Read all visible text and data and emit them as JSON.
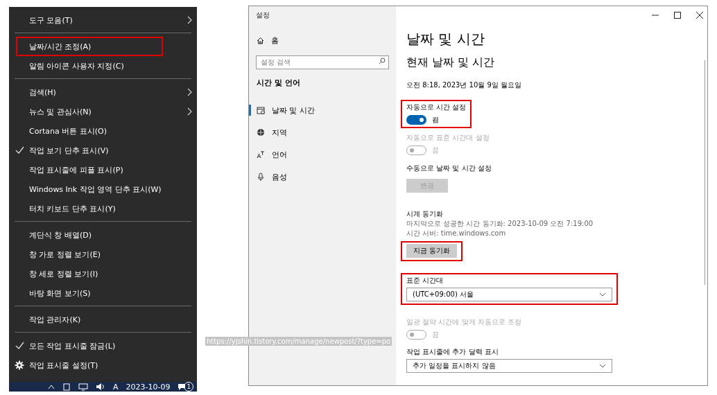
{
  "context_menu": {
    "groups": [
      [
        {
          "label": "도구 모음(T)",
          "kind": "plain",
          "checked": false,
          "submenu": true,
          "marked": false
        }
      ],
      [
        {
          "label": "날짜/시간 조정(A)",
          "kind": "plain",
          "checked": false,
          "submenu": false,
          "marked": true
        },
        {
          "label": "알림 아이콘 사용자 지정(C)",
          "kind": "plain",
          "checked": false,
          "submenu": false,
          "marked": false
        }
      ],
      [
        {
          "label": "검색(H)",
          "kind": "plain",
          "checked": false,
          "submenu": true,
          "marked": false
        },
        {
          "label": "뉴스 및 관심사(N)",
          "kind": "plain",
          "checked": false,
          "submenu": true,
          "marked": false
        },
        {
          "label": "Cortana 버튼 표시(O)",
          "kind": "plain",
          "checked": false,
          "submenu": false,
          "marked": false
        },
        {
          "label": "작업 보기 단추 표시(V)",
          "kind": "plain",
          "checked": true,
          "submenu": false,
          "marked": false
        },
        {
          "label": "작업 표시줄에 피플 표시(P)",
          "kind": "plain",
          "checked": false,
          "submenu": false,
          "marked": false
        },
        {
          "label": "Windows Ink 작업 영역 단추 표시(W)",
          "kind": "plain",
          "checked": false,
          "submenu": false,
          "marked": false
        },
        {
          "label": "터치 키보드 단추 표시(Y)",
          "kind": "plain",
          "checked": false,
          "submenu": false,
          "marked": false
        }
      ],
      [
        {
          "label": "계단식 창 배열(D)",
          "kind": "plain",
          "checked": false,
          "submenu": false,
          "marked": false
        },
        {
          "label": "창 가로 정렬 보기(E)",
          "kind": "plain",
          "checked": false,
          "submenu": false,
          "marked": false
        },
        {
          "label": "창 세로 정렬 보기(I)",
          "kind": "plain",
          "checked": false,
          "submenu": false,
          "marked": false
        },
        {
          "label": "바탕 화면 보기(S)",
          "kind": "plain",
          "checked": false,
          "submenu": false,
          "marked": false
        }
      ],
      [
        {
          "label": "작업 관리자(K)",
          "kind": "plain",
          "checked": false,
          "submenu": false,
          "marked": false
        }
      ],
      [
        {
          "label": "모든 작업 표시줄 잠금(L)",
          "kind": "plain",
          "checked": true,
          "submenu": false,
          "marked": false
        },
        {
          "label": "작업 표시줄 설정(T)",
          "kind": "settings",
          "checked": false,
          "submenu": false,
          "marked": false
        }
      ]
    ]
  },
  "taskbar": {
    "ime": "A",
    "date": "2023-10-09",
    "notification_count": "1"
  },
  "link_tooltip": "https://yjshin.tistory.com/manage/newpost/?type=po",
  "settings_window": {
    "title": "설정",
    "sidebar": {
      "home": "홈",
      "search": {
        "placeholder": "설정 검색"
      },
      "heading": "시간 및 언어",
      "items": [
        {
          "label": "날짜 및 시간",
          "selected": true
        },
        {
          "label": "지역",
          "selected": false
        },
        {
          "label": "언어",
          "selected": false
        },
        {
          "label": "음성",
          "selected": false
        }
      ]
    },
    "content": {
      "title": "날짜 및 시간",
      "subtitle": "현재 날짜 및 시간",
      "current_time": "오전 8:18, 2023년 10월 9일 월요일",
      "sections": [
        {
          "kind": "toggle",
          "label": "자동으로 시간 설정",
          "on": true,
          "state_text": "켬",
          "disabled": false,
          "marked": true
        },
        {
          "kind": "toggle",
          "label": "자동으로 표준 시간대 설정",
          "on": false,
          "state_text": "끔",
          "disabled": true,
          "marked": false
        },
        {
          "kind": "button",
          "label": "수동으로 날짜 및 시간 설정",
          "button": "변경",
          "disabled": true,
          "marked": false
        },
        {
          "kind": "button",
          "label": "시계 동기화",
          "lines": [
            "마지막으로 성공한 시간 동기화: 2023-10-09 오전 7:19:00",
            "시간 서버: time.windows.com"
          ],
          "button": "지금 동기화",
          "disabled": false,
          "marked": true
        },
        {
          "kind": "dropdown",
          "label": "표준 시간대",
          "value": "(UTC+09:00) 서울",
          "marked": true
        },
        {
          "kind": "toggle",
          "label": "일광 절약 시간에 맞게 자동으로 조정",
          "on": false,
          "state_text": "끔",
          "disabled": true,
          "marked": false
        },
        {
          "kind": "dropdown",
          "label": "작업 표시줄에 추가 달력 표시",
          "value": "추가 일정을 표시하지 않음",
          "marked": false
        }
      ]
    }
  }
}
